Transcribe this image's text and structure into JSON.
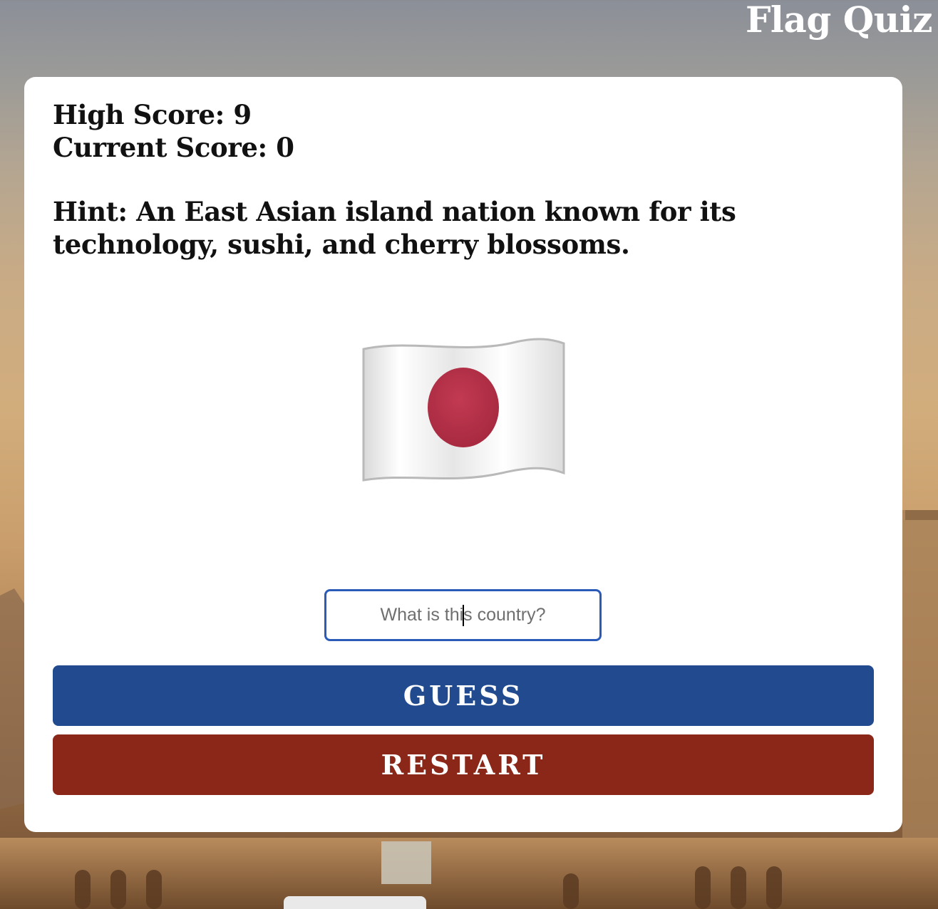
{
  "app": {
    "title": "Flag Quiz"
  },
  "scores": {
    "high_score_label": "High Score: 9",
    "current_score_label": "Current Score: 0"
  },
  "hint": {
    "text": "Hint: An East Asian island nation known for its technology, sushi, and cherry blossoms."
  },
  "flag": {
    "icon": "japan-flag-icon"
  },
  "answer_input": {
    "placeholder": "What is this country?",
    "value": ""
  },
  "buttons": {
    "guess_label": "GUESS",
    "restart_label": "RESTART"
  },
  "colors": {
    "input_border": "#2a5bb8",
    "guess_button": "#214b8e",
    "restart_button": "#8a2718",
    "flag_disc": "#b7334a"
  }
}
